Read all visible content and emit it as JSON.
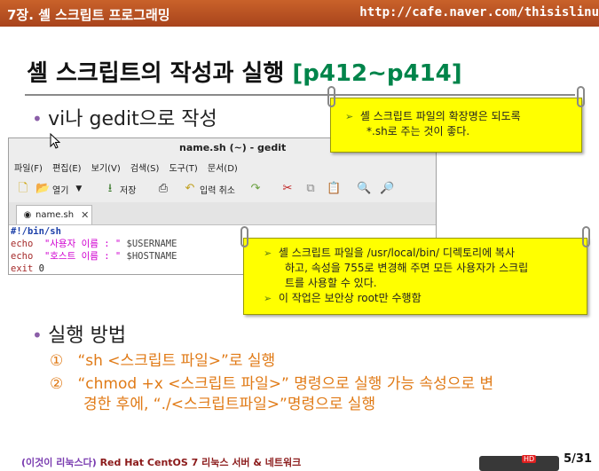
{
  "header": {
    "left": "7장. 셸 스크립트 프로그래밍",
    "right": "http://cafe.naver.com/thisislinu"
  },
  "slide": {
    "title_main": "셸 스크립트의 작성과 실행 ",
    "title_range": "[p412~p414]",
    "bullet1": "vi나 gedit으로 작성",
    "bullet2": "실행 방법",
    "item1_num": "①",
    "item1": "“sh <스크립트 파일>”로 실행",
    "item2_num": "②",
    "item2_line1": "“chmod +x <스크립트 파일>” 명령으로 실행 가능 속성으로 변",
    "item2_line2": "경한 후에, “./<스크립트파일>”명령으로 실행"
  },
  "note1": {
    "line1": "셸 스크립트 파일의 확장명은 되도록",
    "line2": "*.sh로 주는 것이 좋다."
  },
  "note2": {
    "line1": "셸 스크립트 파일을 /usr/local/bin/ 디렉토리에 복사",
    "line2": "하고, 속성을 755로 변경해 주면 모든 사용자가 스크립",
    "line3": "트를 사용할 수 있다.",
    "line4": "이 작업은 보안상 root만 수행함"
  },
  "gedit": {
    "title": "name.sh (~) - gedit",
    "menu": [
      "파일(F)",
      "편집(E)",
      "보기(V)",
      "검색(S)",
      "도구(T)",
      "문서(D)"
    ],
    "toolbar": {
      "open": "열기",
      "save": "저장",
      "undo": "입력 취소"
    },
    "tab": "name.sh",
    "code": {
      "shebang": "#!/bin/sh",
      "echo1_kw": "echo",
      "echo1_str": "\"사용자 이름 : \"",
      "echo1_var": "$USERNAME",
      "echo2_kw": "echo",
      "echo2_str": "\"호스트 이름 : \"",
      "echo2_var": "$HOSTNAME",
      "exit_kw": "exit",
      "exit_val": "0"
    }
  },
  "footer": {
    "prefix": "(이것이 리눅스다)",
    "text": " Red Hat CentOS 7 리눅스 서버 & 네트워크",
    "page": "5/31",
    "hd": "HD"
  },
  "colors": {
    "header": "#b24e22",
    "title_range": "#00844a",
    "note_bg": "#ffff00",
    "ordered_item": "#e07a16",
    "bullet": "#8b5ea8"
  }
}
